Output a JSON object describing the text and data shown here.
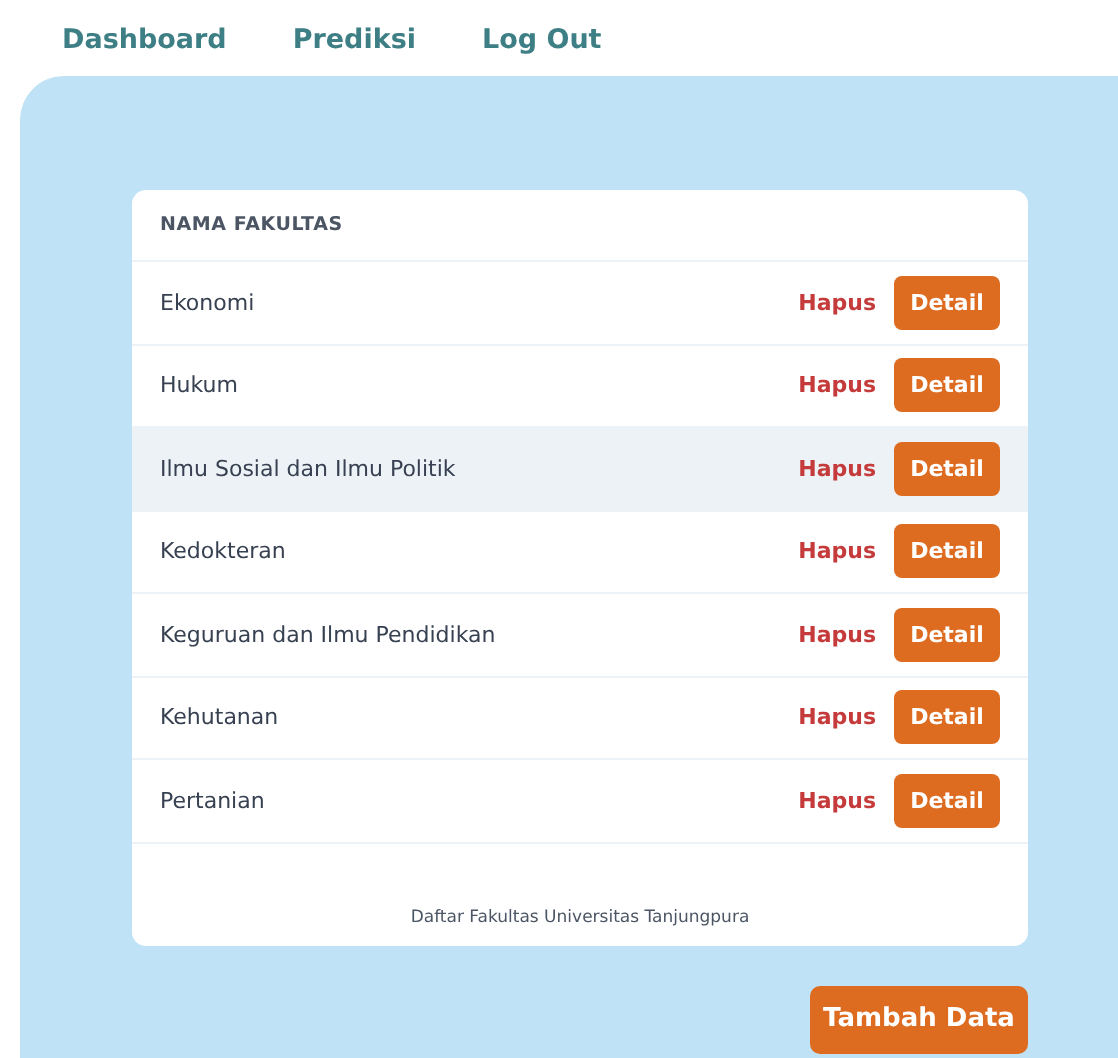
{
  "nav": [
    "Dashboard",
    "Prediksi",
    "Log Out"
  ],
  "table": {
    "column": "NAMA FAKULTAS",
    "rows": [
      {
        "name": "Ekonomi",
        "delete": "Hapus",
        "detail": "Detail",
        "selected": false
      },
      {
        "name": "Hukum",
        "delete": "Hapus",
        "detail": "Detail",
        "selected": false
      },
      {
        "name": "Ilmu Sosial dan Ilmu Politik",
        "delete": "Hapus",
        "detail": "Detail",
        "selected": true
      },
      {
        "name": "Kedokteran",
        "delete": "Hapus",
        "detail": "Detail",
        "selected": false
      },
      {
        "name": "Keguruan dan Ilmu Pendidikan",
        "delete": "Hapus",
        "detail": "Detail",
        "selected": false
      },
      {
        "name": "Kehutanan",
        "delete": "Hapus",
        "detail": "Detail",
        "selected": false
      },
      {
        "name": "Pertanian",
        "delete": "Hapus",
        "detail": "Detail",
        "selected": false
      }
    ],
    "caption": "Daftar Fakultas Universitas Tanjungpura"
  },
  "add_button": "Tambah Data"
}
